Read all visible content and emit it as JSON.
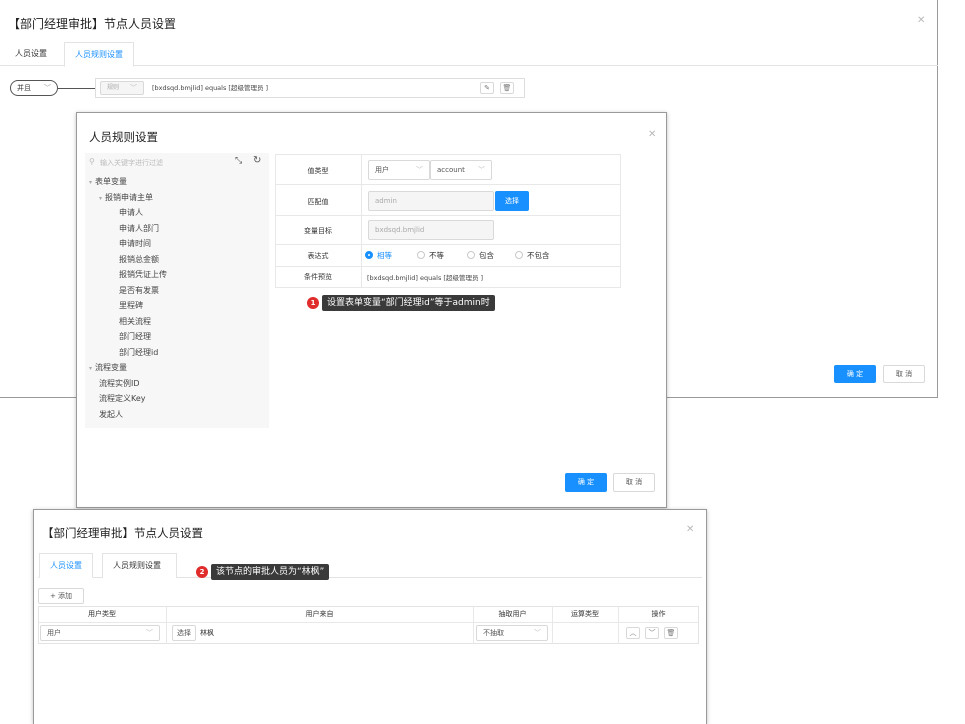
{
  "back_dialog": {
    "title": "【部门经理审批】节点人员设置",
    "tabs": [
      "人员设置",
      "人员规则设置"
    ],
    "active_tab": 1,
    "logic_select": "并且",
    "rule_select_placeholder": "规则",
    "rule_text": "[bxdsqd.bmjlid] equals [超级管理员 ]",
    "confirm_label": "确 定",
    "cancel_label": "取 消"
  },
  "rule_dialog": {
    "title": "人员规则设置",
    "search_placeholder": "输入关键字进行过滤",
    "tree": [
      {
        "label": "表单变量",
        "level": 0,
        "expanded": true
      },
      {
        "label": "报销申请主单",
        "level": 1,
        "expanded": true
      },
      {
        "label": "申请人",
        "level": 2
      },
      {
        "label": "申请人部门",
        "level": 2
      },
      {
        "label": "申请时间",
        "level": 2
      },
      {
        "label": "报销总金额",
        "level": 2
      },
      {
        "label": "报销凭证上传",
        "level": 2
      },
      {
        "label": "是否有发票",
        "level": 2
      },
      {
        "label": "里程碑",
        "level": 2
      },
      {
        "label": "相关流程",
        "level": 2
      },
      {
        "label": "部门经理",
        "level": 2
      },
      {
        "label": "部门经理id",
        "level": 2
      },
      {
        "label": "流程变量",
        "level": 0,
        "expanded": true
      },
      {
        "label": "流程实例ID",
        "level": 1
      },
      {
        "label": "流程定义Key",
        "level": 1
      },
      {
        "label": "发起人",
        "level": 1
      }
    ],
    "form": {
      "value_type_label": "值类型",
      "value_type_select": "用户",
      "value_type_sub_select": "account",
      "match_value_label": "匹配值",
      "match_value_input": "admin",
      "select_button": "选择",
      "var_target_label": "变量目标",
      "var_target_input": "bxdsqd.bmjlid",
      "expression_label": "表达式",
      "expression_options": [
        "相等",
        "不等",
        "包含",
        "不包含"
      ],
      "expression_selected": 0,
      "preview_label": "条件预览",
      "preview_value": "[bxdsqd.bmjlid] equals [超级管理员 ]"
    },
    "confirm_label": "确 定",
    "cancel_label": "取 消"
  },
  "callouts": [
    {
      "number": "1",
      "text": "设置表单变量“部门经理id”等于admin时"
    },
    {
      "number": "2",
      "text": "该节点的审批人员为“林枫”"
    }
  ],
  "front_dialog": {
    "title": "【部门经理审批】节点人员设置",
    "tabs": [
      "人员设置",
      "人员规则设置"
    ],
    "active_tab": 0,
    "add_button": "+ 添加",
    "columns": [
      "用户类型",
      "用户来自",
      "抽取用户",
      "运算类型",
      "操作"
    ],
    "rows": [
      {
        "user_type": "用户",
        "select_button": "选择",
        "source": "林枫",
        "extract": "不抽取",
        "op_type": ""
      }
    ]
  },
  "icons": {
    "collapse": "collapse-icon",
    "refresh": "refresh-icon",
    "search": "search-icon",
    "edit": "edit-icon",
    "delete": "delete-icon",
    "up": "arrow-up-icon",
    "down": "arrow-down-icon",
    "close": "close-icon"
  },
  "colors": {
    "primary": "#1890ff",
    "callout": "#e12c2c"
  }
}
